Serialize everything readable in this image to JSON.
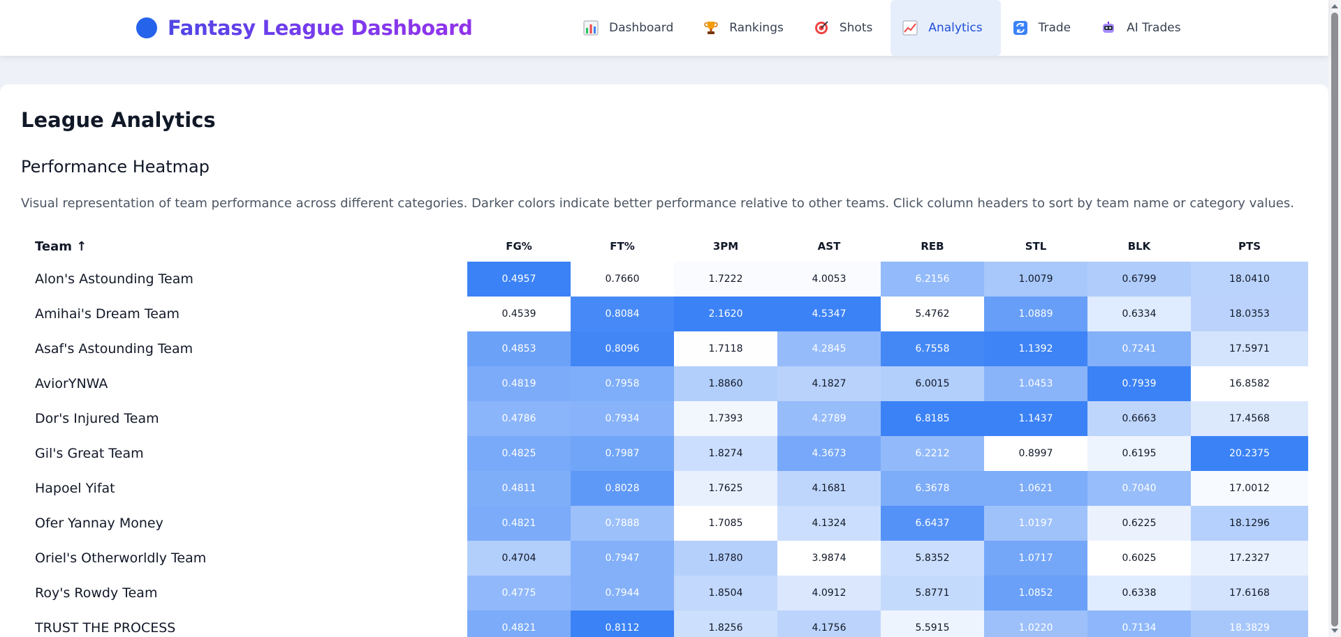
{
  "header": {
    "brand_title": "Fantasy League Dashboard",
    "nav": [
      {
        "label": "Dashboard",
        "icon": "bar-chart-icon",
        "active": false
      },
      {
        "label": "Rankings",
        "icon": "trophy-icon",
        "active": false
      },
      {
        "label": "Shots",
        "icon": "target-icon",
        "active": false
      },
      {
        "label": "Analytics",
        "icon": "trend-chart-icon",
        "active": true
      },
      {
        "label": "Trade",
        "icon": "swap-icon",
        "active": false
      },
      {
        "label": "AI Trades",
        "icon": "robot-icon",
        "active": false
      }
    ]
  },
  "page": {
    "title": "League Analytics",
    "section_title": "Performance Heatmap",
    "description": "Visual representation of team performance across different categories. Darker colors indicate better performance relative to other teams. Click column headers to sort by team name or category values."
  },
  "colors": {
    "accent": "#2563eb",
    "heat_low": "#ffffff",
    "heat_high": "#3b82f6"
  },
  "table": {
    "team_header": "Team ↑",
    "columns": [
      "FG%",
      "FT%",
      "3PM",
      "AST",
      "REB",
      "STL",
      "BLK",
      "PTS"
    ],
    "rows": [
      {
        "team": "Alon's Astounding Team",
        "values": [
          "0.4957",
          "0.7660",
          "1.7222",
          "4.0053",
          "6.2156",
          "1.0079",
          "0.6799",
          "18.0410"
        ]
      },
      {
        "team": "Amihai's Dream Team",
        "values": [
          "0.4539",
          "0.8084",
          "2.1620",
          "4.5347",
          "5.4762",
          "1.0889",
          "0.6334",
          "18.0353"
        ]
      },
      {
        "team": "Asaf's Astounding Team",
        "values": [
          "0.4853",
          "0.8096",
          "1.7118",
          "4.2845",
          "6.7558",
          "1.1392",
          "0.7241",
          "17.5971"
        ]
      },
      {
        "team": "AviorYNWA",
        "values": [
          "0.4819",
          "0.7958",
          "1.8860",
          "4.1827",
          "6.0015",
          "1.0453",
          "0.7939",
          "16.8582"
        ]
      },
      {
        "team": "Dor's Injured Team",
        "values": [
          "0.4786",
          "0.7934",
          "1.7393",
          "4.2789",
          "6.8185",
          "1.1437",
          "0.6663",
          "17.4568"
        ]
      },
      {
        "team": "Gil's Great Team",
        "values": [
          "0.4825",
          "0.7987",
          "1.8274",
          "4.3673",
          "6.2212",
          "0.8997",
          "0.6195",
          "20.2375"
        ]
      },
      {
        "team": "Hapoel Yifat",
        "values": [
          "0.4811",
          "0.8028",
          "1.7625",
          "4.1681",
          "6.3678",
          "1.0621",
          "0.7040",
          "17.0012"
        ]
      },
      {
        "team": "Ofer Yannay Money",
        "values": [
          "0.4821",
          "0.7888",
          "1.7085",
          "4.1324",
          "6.6437",
          "1.0197",
          "0.6225",
          "18.1296"
        ]
      },
      {
        "team": "Oriel's Otherworldly Team",
        "values": [
          "0.4704",
          "0.7947",
          "1.8780",
          "3.9874",
          "5.8352",
          "1.0717",
          "0.6025",
          "17.2327"
        ]
      },
      {
        "team": "Roy's Rowdy Team",
        "values": [
          "0.4775",
          "0.7944",
          "1.8504",
          "4.0912",
          "5.8771",
          "1.0852",
          "0.6338",
          "17.6168"
        ]
      },
      {
        "team": "TRUST THE PROCESS",
        "values": [
          "0.4821",
          "0.8112",
          "1.8256",
          "4.1756",
          "5.5915",
          "1.0220",
          "0.7134",
          "18.3829"
        ]
      }
    ]
  }
}
